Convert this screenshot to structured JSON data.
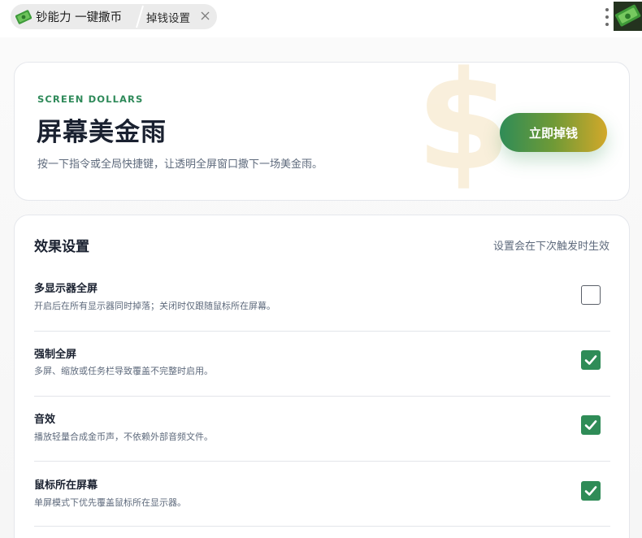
{
  "tabs": {
    "app_tab_label": "钞能力 一键撒币",
    "settings_tab_label": "掉钱设置"
  },
  "icons": {
    "app": "money-bill-icon",
    "close": "close-icon",
    "menu": "more-vertical-icon",
    "avatar": "money-avatar"
  },
  "colors": {
    "accent_green": "#2f8c57",
    "accent_gold": "#d2a82a"
  },
  "hero": {
    "eyebrow": "SCREEN DOLLARS",
    "title": "屏幕美金雨",
    "description": "按一下指令或全局快捷键，让透明全屏窗口撒下一场美金雨。",
    "cta_label": "立即掉钱"
  },
  "settings": {
    "title": "效果设置",
    "note": "设置会在下次触发时生效",
    "items": [
      {
        "name": "多显示器全屏",
        "description": "开启后在所有显示器同时掉落；关闭时仅跟随鼠标所在屏幕。",
        "checked": false
      },
      {
        "name": "强制全屏",
        "description": "多屏、缩放或任务栏导致覆盖不完整时启用。",
        "checked": true
      },
      {
        "name": "音效",
        "description": "播放轻量合成金币声，不依赖外部音频文件。",
        "checked": true
      },
      {
        "name": "鼠标所在屏幕",
        "description": "单屏模式下优先覆盖鼠标所在显示器。",
        "checked": true
      }
    ]
  }
}
